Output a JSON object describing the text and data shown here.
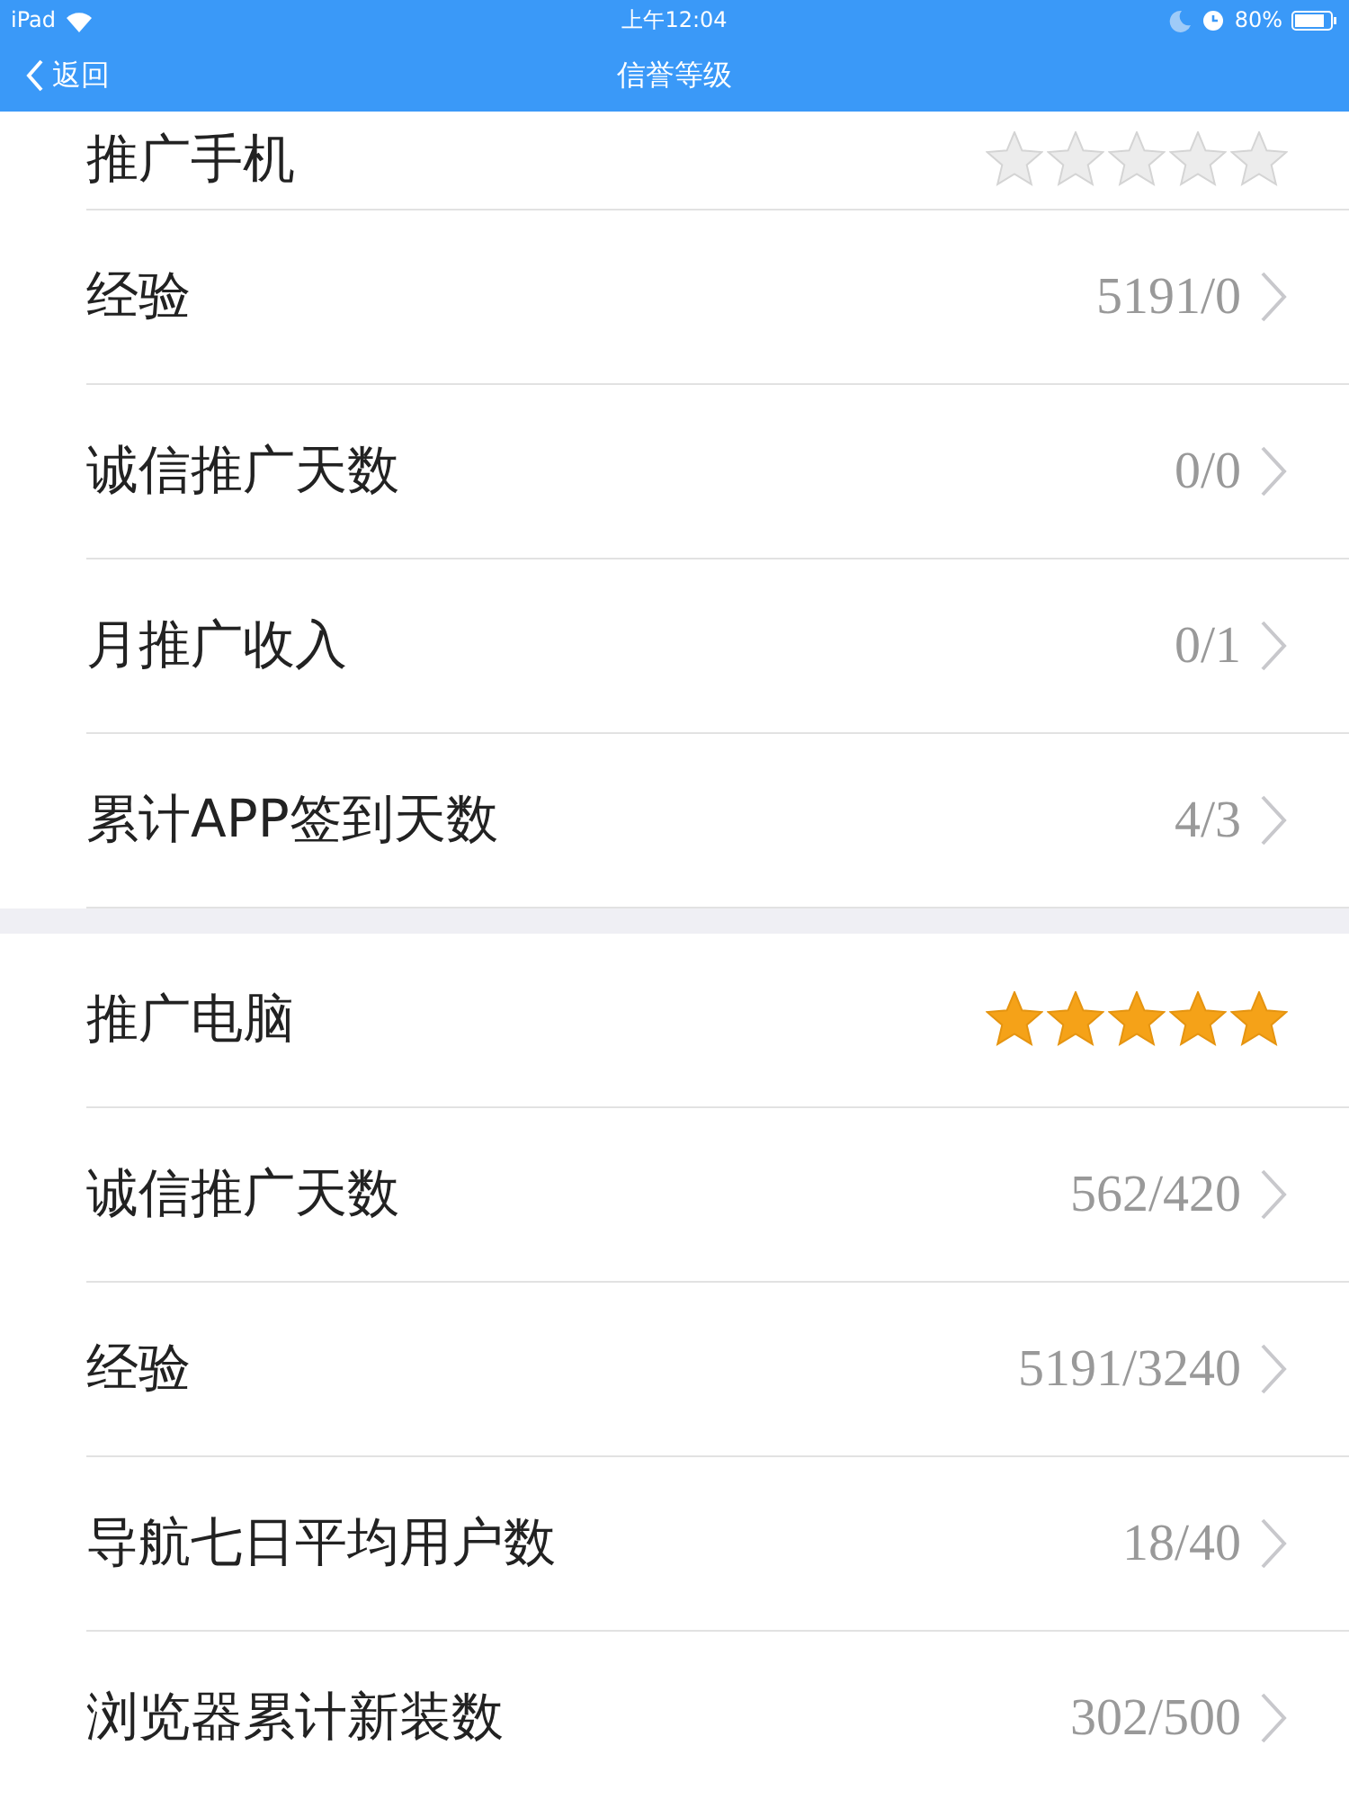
{
  "status_bar": {
    "device": "iPad",
    "time": "上午12:04",
    "battery": "80%"
  },
  "nav": {
    "back": "返回",
    "title": "信誉等级"
  },
  "sections": [
    {
      "title": "推广手机",
      "stars": 0,
      "rows": [
        {
          "label": "经验",
          "value": "5191/0"
        },
        {
          "label": "诚信推广天数",
          "value": "0/0"
        },
        {
          "label": "月推广收入",
          "value": "0/1"
        },
        {
          "label": "累计APP签到天数",
          "value": "4/3"
        }
      ]
    },
    {
      "title": "推广电脑",
      "stars": 5,
      "rows": [
        {
          "label": "诚信推广天数",
          "value": "562/420"
        },
        {
          "label": "经验",
          "value": "5191/3240"
        },
        {
          "label": "导航七日平均用户数",
          "value": "18/40"
        },
        {
          "label": "浏览器累计新装数",
          "value": "302/500"
        }
      ]
    }
  ]
}
